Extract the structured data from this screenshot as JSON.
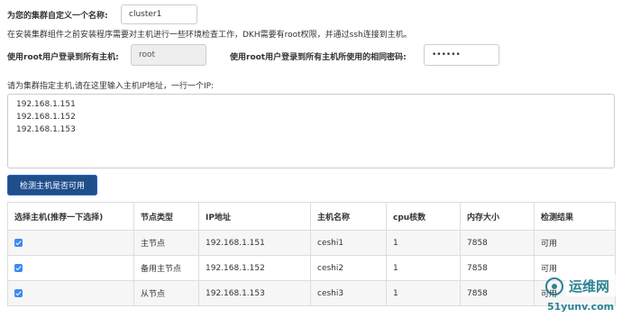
{
  "form": {
    "cluster_name_label": "为您的集群自定义一个名称:",
    "cluster_name_value": "cluster1",
    "env_note": "在安装集群组件之前安装程序需要对主机进行一些环境检查工作，DKH需要有root权限，并通过ssh连接到主机。",
    "root_user_label": "使用root用户登录到所有主机:",
    "root_user_value": "root",
    "root_password_label": "使用root用户登录到所有主机所使用的相同密码:",
    "root_password_value": "••••••",
    "hosts_label": "请为集群指定主机,请在这里输入主机IP地址，一行一个IP:",
    "hosts": [
      "192.168.1.151",
      "192.168.1.152",
      "192.168.1.153"
    ],
    "check_button": "检测主机是否可用"
  },
  "table": {
    "columns": [
      "选择主机(推荐一下选择)",
      "节点类型",
      "IP地址",
      "主机名称",
      "cpu核数",
      "内存大小",
      "检测结果"
    ],
    "rows": [
      {
        "type": "主节点",
        "ip": "192.168.1.151",
        "hostname": "ceshi1",
        "cpu": "1",
        "memory": "7858",
        "result": "可用"
      },
      {
        "type": "备用主节点",
        "ip": "192.168.1.152",
        "hostname": "ceshi2",
        "cpu": "1",
        "memory": "7858",
        "result": "可用"
      },
      {
        "type": "从节点",
        "ip": "192.168.1.153",
        "hostname": "ceshi3",
        "cpu": "1",
        "memory": "7858",
        "result": "可用"
      }
    ]
  },
  "watermark": {
    "line1": "运维网",
    "line2": "51yunv.com"
  },
  "colors": {
    "button": "#1f4e8c",
    "checkbox": "#3b8bf1",
    "watermark": "#1a7a8a"
  }
}
